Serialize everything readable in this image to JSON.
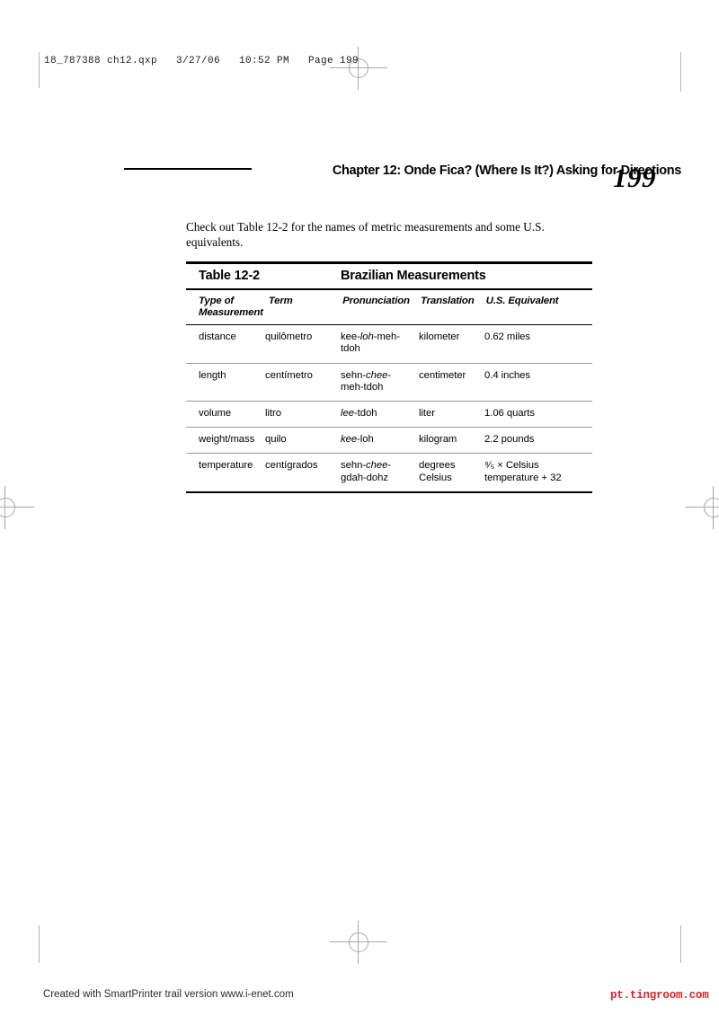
{
  "slug": {
    "text": "18_787388 ch12.qxp   3/27/06   10:52 PM   Page 199"
  },
  "running_head": {
    "title": "Chapter 12: Onde Fica? (Where Is It?) Asking for Directions",
    "folio": "199"
  },
  "intro": {
    "text": "Check out Table 12-2 for the names of metric measurements and some U.S. equivalents."
  },
  "table": {
    "number": "Table 12-2",
    "caption": "Brazilian Measurements",
    "columns": [
      "Type of Measurement",
      "Term",
      "Pronunciation",
      "Translation",
      "U.S. Equivalent"
    ],
    "rows": [
      {
        "type": "distance",
        "term": "quilômetro",
        "pronunciation_pre": "kee-",
        "pronunciation_em": "loh",
        "pronunciation_post": "-meh-tdoh",
        "translation": "kilometer",
        "us_equivalent": "0.62 miles"
      },
      {
        "type": "length",
        "term": "centímetro",
        "pronunciation_pre": "sehn-",
        "pronunciation_em": "chee",
        "pronunciation_post": "-meh-tdoh",
        "translation": "centimeter",
        "us_equivalent": "0.4 inches"
      },
      {
        "type": "volume",
        "term": "litro",
        "pronunciation_pre": "",
        "pronunciation_em": "lee",
        "pronunciation_post": "-tdoh",
        "translation": "liter",
        "us_equivalent": "1.06 quarts"
      },
      {
        "type": "weight/mass",
        "term": "quilo",
        "pronunciation_pre": "",
        "pronunciation_em": "kee",
        "pronunciation_post": "-loh",
        "translation": "kilogram",
        "us_equivalent": "2.2 pounds"
      },
      {
        "type": "temperature",
        "term": "centígrados",
        "pronunciation_pre": "sehn-",
        "pronunciation_em": "chee",
        "pronunciation_post": "-gdah-dohz",
        "translation": "degrees Celsius",
        "us_equivalent": "⁹⁄₅ × Celsius temperature + 32"
      }
    ]
  },
  "footer": {
    "smartprinter": "Created with SmartPrinter trail version www.i-enet.com",
    "watermark": "pt.tingroom.com",
    "watermark_color": "#d2232a"
  }
}
